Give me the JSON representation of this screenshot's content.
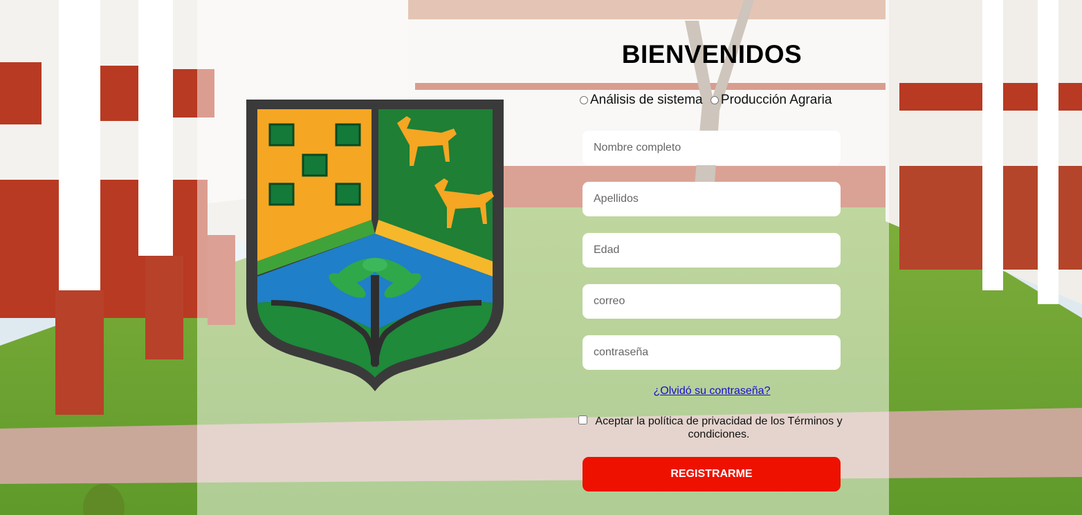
{
  "title": "BIENVENIDOS",
  "careers": {
    "option1": "Análisis de sistema",
    "option2": "Producción Agraria"
  },
  "form": {
    "name_placeholder": "Nombre completo",
    "lastname_placeholder": "Apellidos",
    "age_placeholder": "Edad",
    "email_placeholder": "correo",
    "password_placeholder": "contraseña"
  },
  "forgot_link": "¿Olvidó su contraseña?",
  "terms_text": "Aceptar la política de privacidad de los Términos y condiciones.",
  "submit_label": "REGISTRARME",
  "colors": {
    "submit_bg": "#ee1100",
    "link": "#1a0dcc",
    "crest_orange": "#f5a623",
    "crest_green": "#1e8a3a",
    "crest_blue": "#1f7fc8"
  }
}
